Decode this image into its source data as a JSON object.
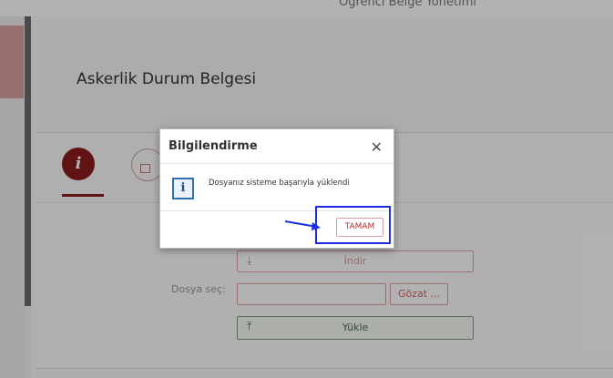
{
  "app": {
    "title": "Öğrenci Belge Yönetimi"
  },
  "page": {
    "document_title": "Askerlik Durum Belgesi"
  },
  "tabs": {
    "info_glyph": "i"
  },
  "form": {
    "download_label": "İndir",
    "file_label": "Dosya seç:",
    "file_value": "",
    "browse_label": "Gözat ...",
    "upload_label": "Yükle"
  },
  "modal": {
    "title": "Bilgilendirme",
    "close_glyph": "✕",
    "icon_glyph": "i",
    "message": "Dosyanız sisteme başarıyla yüklendi",
    "ok_label": "TAMAM"
  },
  "colors": {
    "accent": "#8b1a1a",
    "highlight": "#1d2de0",
    "success": "#7aa07a"
  }
}
